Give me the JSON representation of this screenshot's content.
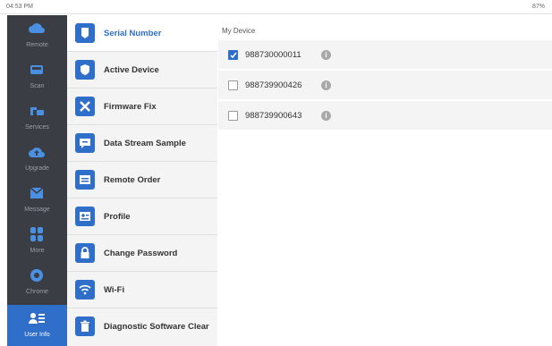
{
  "status_bar": {
    "time": "04:53 PM",
    "battery": "87%"
  },
  "left_nav": [
    {
      "label": "Remote",
      "icon": "cloud-icon"
    },
    {
      "label": "Scan",
      "icon": "car-icon"
    },
    {
      "label": "Services",
      "icon": "wrench-car-icon"
    },
    {
      "label": "Upgrade",
      "icon": "cloud-upload-icon"
    },
    {
      "label": "Message",
      "icon": "envelope-icon"
    },
    {
      "label": "More",
      "icon": "grid-icon"
    },
    {
      "label": "Chrome",
      "icon": "chrome-icon"
    },
    {
      "label": "User Info",
      "icon": "user-settings-icon",
      "active": true
    }
  ],
  "menu": [
    {
      "label": "Serial Number",
      "icon": "badge-icon",
      "active": true
    },
    {
      "label": "Active Device",
      "icon": "shield-icon"
    },
    {
      "label": "Firmware Fix",
      "icon": "tools-icon"
    },
    {
      "label": "Data Stream Sample",
      "icon": "chat-icon"
    },
    {
      "label": "Remote Order",
      "icon": "list-icon"
    },
    {
      "label": "Profile",
      "icon": "id-card-icon"
    },
    {
      "label": "Change Password",
      "icon": "lock-icon"
    },
    {
      "label": "Wi-Fi",
      "icon": "wifi-icon"
    },
    {
      "label": "Diagnostic Software Clear",
      "icon": "trash-icon"
    }
  ],
  "content": {
    "section_title": "My Device",
    "devices": [
      {
        "serial": "988730000011",
        "checked": true
      },
      {
        "serial": "988739900426",
        "checked": false
      },
      {
        "serial": "988739900643",
        "checked": false
      }
    ]
  },
  "colors": {
    "accent": "#2f6fc9",
    "nav_bg": "#3a3d43",
    "menu_bg": "#f4f4f4"
  }
}
